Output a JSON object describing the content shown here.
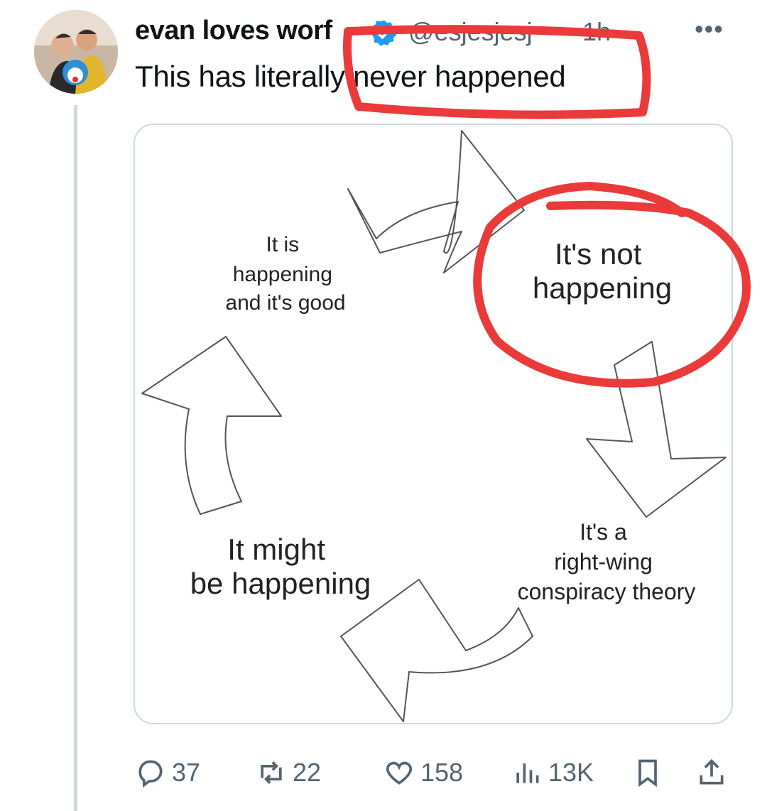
{
  "user": {
    "display_name": "evan loves worf",
    "handle": "@esjesjesj",
    "time": "1h"
  },
  "tweet": {
    "text": "This has literally never happened"
  },
  "diagram": {
    "top_left": [
      "It is",
      "happening",
      "and it's good"
    ],
    "top_right": [
      "It's not",
      "happening"
    ],
    "bottom_right": [
      "It's a",
      "right-wing",
      "conspiracy theory"
    ],
    "bottom_left": [
      "It might",
      "be happening"
    ]
  },
  "actions": {
    "replies": "37",
    "reposts": "22",
    "likes": "158",
    "views": "13K"
  },
  "colors": {
    "annotation_red": "#ea3a3a",
    "verified_blue": "#1d9bf0",
    "muted": "#536471"
  },
  "icons": [
    "more-icon",
    "verified-icon",
    "reply-icon",
    "repost-icon",
    "like-icon",
    "views-icon",
    "bookmark-icon",
    "share-icon"
  ]
}
